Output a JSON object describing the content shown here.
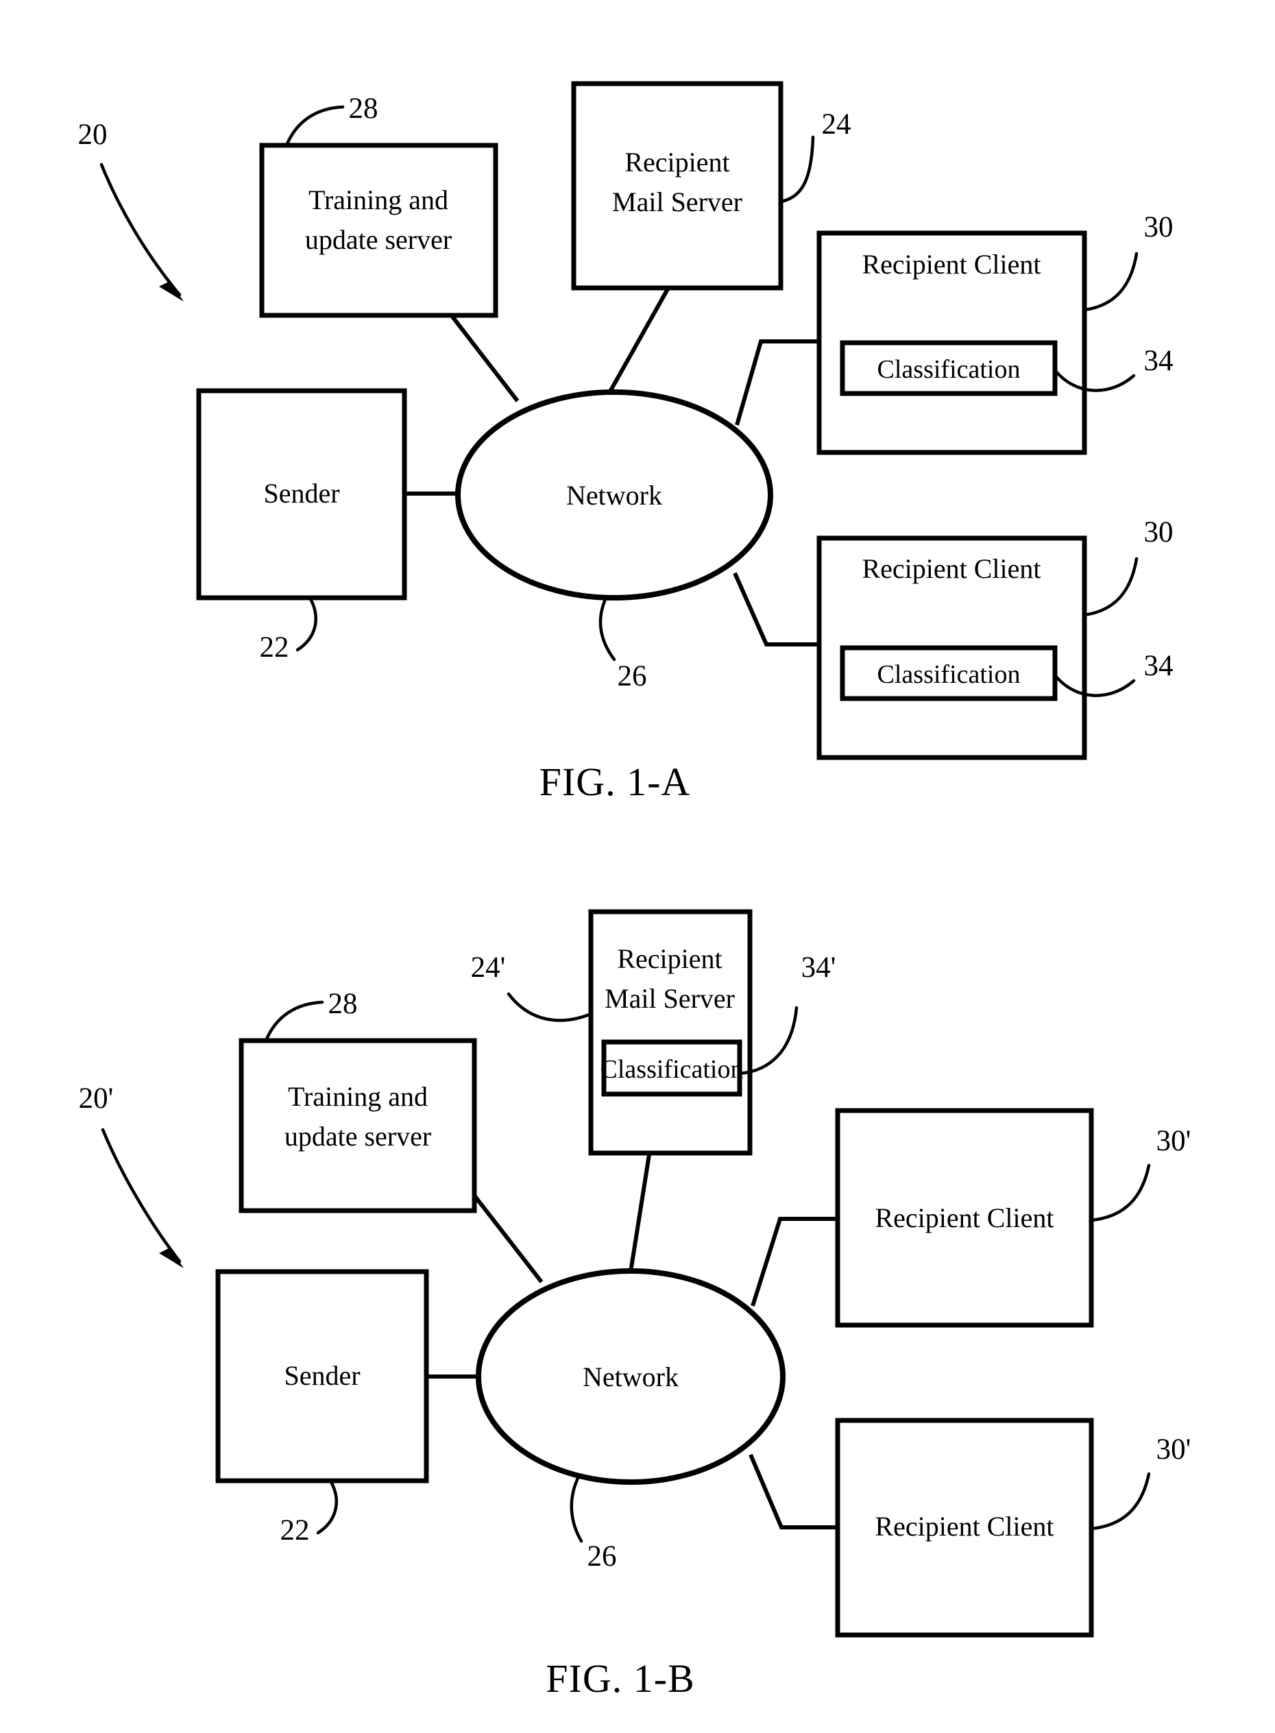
{
  "document": {
    "type": "patent-drawing-sheet",
    "background_color": "#ffffff",
    "ink_color": "#000000"
  },
  "figures": [
    {
      "id": "fig-1a",
      "caption": "FIG. 1-A",
      "system_reference": "20",
      "nodes": [
        {
          "key": "training_server",
          "label_line1": "Training and",
          "label_line2": "update server",
          "reference": "28",
          "shape": "rect"
        },
        {
          "key": "recipient_mail_server",
          "label_line1": "Recipient",
          "label_line2": "Mail Server",
          "reference": "24",
          "shape": "rect"
        },
        {
          "key": "sender",
          "label_line1": "Sender",
          "label_line2": "",
          "reference": "22",
          "shape": "rect"
        },
        {
          "key": "network",
          "label_line1": "Network",
          "label_line2": "",
          "reference": "26",
          "shape": "ellipse"
        },
        {
          "key": "recipient_client_top",
          "label_line1": "Recipient Client",
          "label_line2": "",
          "reference": "30",
          "shape": "rect",
          "inner": {
            "key": "classification_top",
            "label": "Classification",
            "reference": "34"
          }
        },
        {
          "key": "recipient_client_bottom",
          "label_line1": "Recipient Client",
          "label_line2": "",
          "reference": "30",
          "shape": "rect",
          "inner": {
            "key": "classification_bottom",
            "label": "Classification",
            "reference": "34"
          }
        }
      ],
      "connections": [
        {
          "from": "training_server",
          "to": "network"
        },
        {
          "from": "recipient_mail_server",
          "to": "network"
        },
        {
          "from": "sender",
          "to": "network"
        },
        {
          "from": "network",
          "to": "recipient_client_top"
        },
        {
          "from": "network",
          "to": "recipient_client_bottom"
        }
      ]
    },
    {
      "id": "fig-1b",
      "caption": "FIG. 1-B",
      "system_reference": "20'",
      "nodes": [
        {
          "key": "training_server",
          "label_line1": "Training and",
          "label_line2": "update server",
          "reference": "28",
          "shape": "rect"
        },
        {
          "key": "recipient_mail_server",
          "label_line1": "Recipient",
          "label_line2": "Mail Server",
          "reference": "24'",
          "shape": "rect",
          "inner": {
            "key": "classification_server",
            "label": "Classification",
            "reference": "34'"
          }
        },
        {
          "key": "sender",
          "label_line1": "Sender",
          "label_line2": "",
          "reference": "22",
          "shape": "rect"
        },
        {
          "key": "network",
          "label_line1": "Network",
          "label_line2": "",
          "reference": "26",
          "shape": "ellipse"
        },
        {
          "key": "recipient_client_top",
          "label_line1": "Recipient Client",
          "label_line2": "",
          "reference": "30'",
          "shape": "rect"
        },
        {
          "key": "recipient_client_bottom",
          "label_line1": "Recipient Client",
          "label_line2": "",
          "reference": "30'",
          "shape": "rect"
        }
      ],
      "connections": [
        {
          "from": "training_server",
          "to": "network"
        },
        {
          "from": "recipient_mail_server",
          "to": "network"
        },
        {
          "from": "sender",
          "to": "network"
        },
        {
          "from": "network",
          "to": "recipient_client_top"
        },
        {
          "from": "network",
          "to": "recipient_client_bottom"
        }
      ]
    }
  ],
  "fig1a": {
    "caption": "FIG. 1-A",
    "ref_system": "20",
    "training_server": {
      "line1": "Training and",
      "line2": "update server",
      "ref": "28"
    },
    "mail_server": {
      "line1": "Recipient",
      "line2": "Mail Server",
      "ref": "24"
    },
    "sender": {
      "label": "Sender",
      "ref": "22"
    },
    "network": {
      "label": "Network",
      "ref": "26"
    },
    "client_top": {
      "label": "Recipient Client",
      "ref": "30",
      "inner_label": "Classification",
      "inner_ref": "34"
    },
    "client_bottom": {
      "label": "Recipient Client",
      "ref": "30",
      "inner_label": "Classification",
      "inner_ref": "34"
    }
  },
  "fig1b": {
    "caption": "FIG. 1-B",
    "ref_system": "20'",
    "training_server": {
      "line1": "Training and",
      "line2": "update server",
      "ref": "28"
    },
    "mail_server": {
      "line1": "Recipient",
      "line2": "Mail Server",
      "ref": "24'",
      "inner_label": "Classification",
      "inner_ref": "34'"
    },
    "sender": {
      "label": "Sender",
      "ref": "22"
    },
    "network": {
      "label": "Network",
      "ref": "26"
    },
    "client_top": {
      "label": "Recipient Client",
      "ref": "30'"
    },
    "client_bottom": {
      "label": "Recipient Client",
      "ref": "30'"
    }
  }
}
